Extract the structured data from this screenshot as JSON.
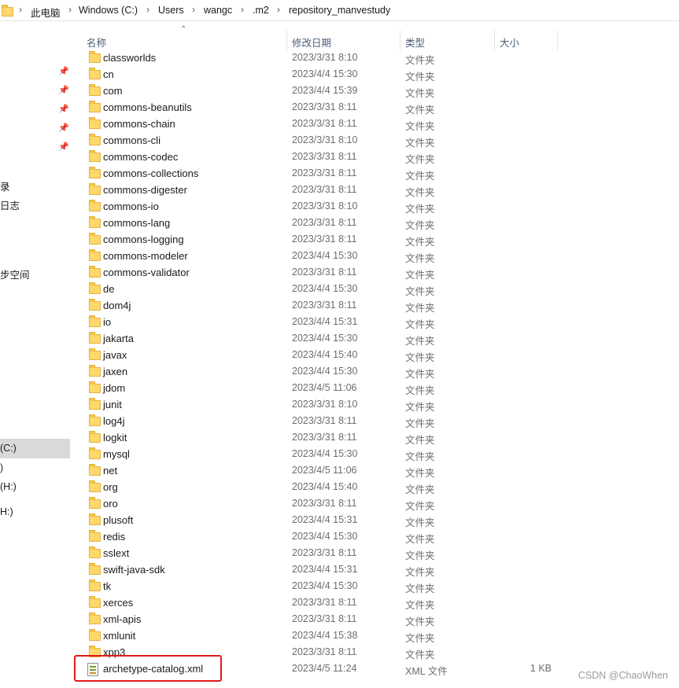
{
  "breadcrumb": [
    "此电脑",
    "Windows (C:)",
    "Users",
    "wangc",
    ".m2",
    "repository_manvestudy"
  ],
  "nav": {
    "items": [
      "录",
      "日志",
      "步空间",
      "(C:)",
      ")",
      "(H:)",
      "H:)"
    ],
    "selected_index": 3
  },
  "columns": {
    "name": "名称",
    "date": "修改日期",
    "type": "类型",
    "size": "大小"
  },
  "rows": [
    {
      "name": "classworlds",
      "date": "2023/3/31 8:10",
      "type": "文件夹",
      "size": "",
      "kind": "folder"
    },
    {
      "name": "cn",
      "date": "2023/4/4 15:30",
      "type": "文件夹",
      "size": "",
      "kind": "folder"
    },
    {
      "name": "com",
      "date": "2023/4/4 15:39",
      "type": "文件夹",
      "size": "",
      "kind": "folder"
    },
    {
      "name": "commons-beanutils",
      "date": "2023/3/31 8:11",
      "type": "文件夹",
      "size": "",
      "kind": "folder"
    },
    {
      "name": "commons-chain",
      "date": "2023/3/31 8:11",
      "type": "文件夹",
      "size": "",
      "kind": "folder"
    },
    {
      "name": "commons-cli",
      "date": "2023/3/31 8:10",
      "type": "文件夹",
      "size": "",
      "kind": "folder"
    },
    {
      "name": "commons-codec",
      "date": "2023/3/31 8:11",
      "type": "文件夹",
      "size": "",
      "kind": "folder"
    },
    {
      "name": "commons-collections",
      "date": "2023/3/31 8:11",
      "type": "文件夹",
      "size": "",
      "kind": "folder"
    },
    {
      "name": "commons-digester",
      "date": "2023/3/31 8:11",
      "type": "文件夹",
      "size": "",
      "kind": "folder"
    },
    {
      "name": "commons-io",
      "date": "2023/3/31 8:10",
      "type": "文件夹",
      "size": "",
      "kind": "folder"
    },
    {
      "name": "commons-lang",
      "date": "2023/3/31 8:11",
      "type": "文件夹",
      "size": "",
      "kind": "folder"
    },
    {
      "name": "commons-logging",
      "date": "2023/3/31 8:11",
      "type": "文件夹",
      "size": "",
      "kind": "folder"
    },
    {
      "name": "commons-modeler",
      "date": "2023/4/4 15:30",
      "type": "文件夹",
      "size": "",
      "kind": "folder"
    },
    {
      "name": "commons-validator",
      "date": "2023/3/31 8:11",
      "type": "文件夹",
      "size": "",
      "kind": "folder"
    },
    {
      "name": "de",
      "date": "2023/4/4 15:30",
      "type": "文件夹",
      "size": "",
      "kind": "folder"
    },
    {
      "name": "dom4j",
      "date": "2023/3/31 8:11",
      "type": "文件夹",
      "size": "",
      "kind": "folder"
    },
    {
      "name": "io",
      "date": "2023/4/4 15:31",
      "type": "文件夹",
      "size": "",
      "kind": "folder"
    },
    {
      "name": "jakarta",
      "date": "2023/4/4 15:30",
      "type": "文件夹",
      "size": "",
      "kind": "folder"
    },
    {
      "name": "javax",
      "date": "2023/4/4 15:40",
      "type": "文件夹",
      "size": "",
      "kind": "folder"
    },
    {
      "name": "jaxen",
      "date": "2023/4/4 15:30",
      "type": "文件夹",
      "size": "",
      "kind": "folder"
    },
    {
      "name": "jdom",
      "date": "2023/4/5 11:06",
      "type": "文件夹",
      "size": "",
      "kind": "folder"
    },
    {
      "name": "junit",
      "date": "2023/3/31 8:10",
      "type": "文件夹",
      "size": "",
      "kind": "folder"
    },
    {
      "name": "log4j",
      "date": "2023/3/31 8:11",
      "type": "文件夹",
      "size": "",
      "kind": "folder"
    },
    {
      "name": "logkit",
      "date": "2023/3/31 8:11",
      "type": "文件夹",
      "size": "",
      "kind": "folder"
    },
    {
      "name": "mysql",
      "date": "2023/4/4 15:30",
      "type": "文件夹",
      "size": "",
      "kind": "folder"
    },
    {
      "name": "net",
      "date": "2023/4/5 11:06",
      "type": "文件夹",
      "size": "",
      "kind": "folder"
    },
    {
      "name": "org",
      "date": "2023/4/4 15:40",
      "type": "文件夹",
      "size": "",
      "kind": "folder"
    },
    {
      "name": "oro",
      "date": "2023/3/31 8:11",
      "type": "文件夹",
      "size": "",
      "kind": "folder"
    },
    {
      "name": "plusoft",
      "date": "2023/4/4 15:31",
      "type": "文件夹",
      "size": "",
      "kind": "folder"
    },
    {
      "name": "redis",
      "date": "2023/4/4 15:30",
      "type": "文件夹",
      "size": "",
      "kind": "folder"
    },
    {
      "name": "sslext",
      "date": "2023/3/31 8:11",
      "type": "文件夹",
      "size": "",
      "kind": "folder"
    },
    {
      "name": "swift-java-sdk",
      "date": "2023/4/4 15:31",
      "type": "文件夹",
      "size": "",
      "kind": "folder"
    },
    {
      "name": "tk",
      "date": "2023/4/4 15:30",
      "type": "文件夹",
      "size": "",
      "kind": "folder"
    },
    {
      "name": "xerces",
      "date": "2023/3/31 8:11",
      "type": "文件夹",
      "size": "",
      "kind": "folder"
    },
    {
      "name": "xml-apis",
      "date": "2023/3/31 8:11",
      "type": "文件夹",
      "size": "",
      "kind": "folder"
    },
    {
      "name": "xmlunit",
      "date": "2023/4/4 15:38",
      "type": "文件夹",
      "size": "",
      "kind": "folder"
    },
    {
      "name": "xpp3",
      "date": "2023/3/31 8:11",
      "type": "文件夹",
      "size": "",
      "kind": "folder"
    },
    {
      "name": "archetype-catalog.xml",
      "date": "2023/4/5 11:24",
      "type": "XML 文件",
      "size": "1 KB",
      "kind": "xml"
    }
  ],
  "watermark": "CSDN @ChaoWhen",
  "colors": {
    "highlight": "#e11b1b",
    "folder": "#ffd86b",
    "nav_selected": "#d9d9d9"
  }
}
